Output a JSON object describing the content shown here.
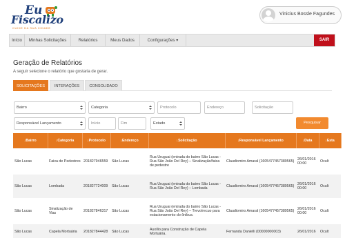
{
  "logo": {
    "line1": "Eu",
    "line2": "Fiscalizo",
    "tagline": "CUIDE DA SUA CIDADE"
  },
  "user": {
    "name": "Vinicius Bossle Fagundes"
  },
  "nav": {
    "items": [
      "Início",
      "Minhas Solicitações",
      "Relatórios",
      "Meus Dados",
      "Configurações ▾"
    ],
    "logout": "SAIR"
  },
  "page": {
    "title": "Geração de Relatórios",
    "subtitle": "A seguir selecione o relatório que gostaria de gerar."
  },
  "tabs": [
    "SOLICITAÇÕES",
    "INTERAÇÕES",
    "CONSOLIDADO"
  ],
  "filters": {
    "bairro": "Bairro",
    "categoria": "Categoria",
    "protocolo": "Protocolo",
    "endereco": "Endereço",
    "solicitacao": "Solicitação",
    "responsavel": "Responsável Lançamento",
    "inicio": "Início",
    "fim": "Fim",
    "estado": "Estado",
    "search_button": "Pesquisar"
  },
  "table": {
    "headers": [
      "↓Bairro",
      "↓Categoria",
      "↓Protocolo",
      "↓Endereço",
      "↓Solicitação",
      "↓Responsável Lançamento",
      "↓Data",
      "↓Esta"
    ],
    "rows": [
      [
        "São Lucas",
        "Faixa de Pedestres",
        "201827946559",
        "São Lucas",
        "Rua Uruguai (entrada do bairro São Lucas - Rua São João Del Rey) – Sinalização/faixa de pedestre",
        "Claudiomiro Amaral (1605477457389565)",
        "26/01/2016 00:00",
        "Ocult"
      ],
      [
        "São Lucas",
        "Lombada",
        "201827724009",
        "São Lucas",
        "Rua Uruguai (entrada do bairro São Lucas - Rua São João Del Rey) – Lombada",
        "Claudiomiro Amaral (1605477457389565)",
        "26/01/2016 00:00",
        "Ocult"
      ],
      [
        "São Lucas",
        "Sinalização de Vias",
        "201827846317",
        "São Lucas",
        "Rua Uruguai (entrada do bairro São Lucas - Rua São João Del Rey) – Trevo/recuo para estacionamento do ônibus.",
        "Claudiomiro Amaral (1605477457389565)",
        "26/01/2016 00:00",
        "Ocult"
      ],
      [
        "São Lucas",
        "Capela Mortuária",
        "201827844428",
        "São Lucas",
        "Auxílio para Construção de Capela Mortuária.",
        "Fernanda Danielli (00000000003)",
        "26/01/2016",
        "Ocult"
      ]
    ]
  },
  "colors": {
    "accent": "#e5781e",
    "logout": "#c0101b",
    "brand_blue": "#1f3f7a"
  }
}
